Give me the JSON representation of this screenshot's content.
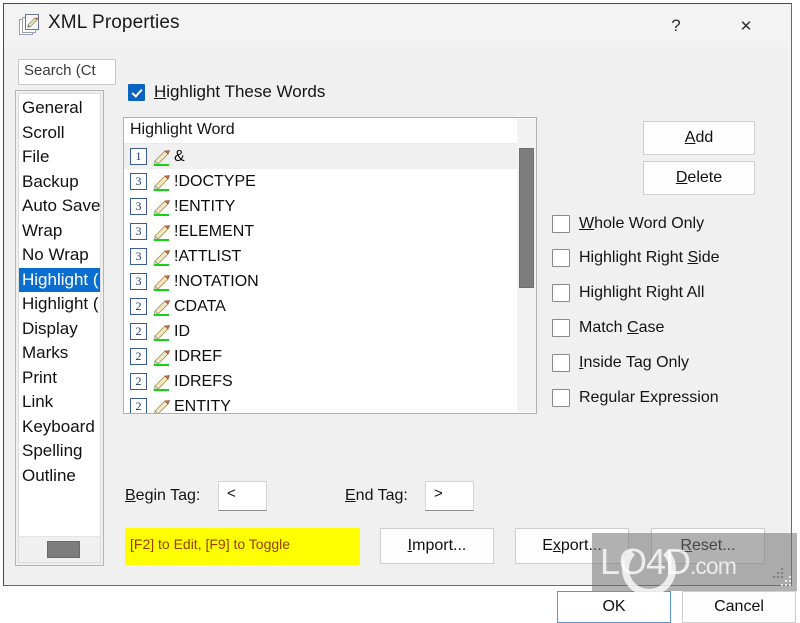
{
  "window": {
    "title": "XML Properties",
    "icon": "document-properties-icon",
    "help_label": "?",
    "close_label": "✕"
  },
  "sidebar": {
    "search": {
      "value": "Search (Ct",
      "placeholder": "Search (Ctrl+E)"
    },
    "items": [
      {
        "label": "General",
        "selected": false
      },
      {
        "label": "Scroll",
        "selected": false
      },
      {
        "label": "File",
        "selected": false
      },
      {
        "label": "Backup",
        "selected": false
      },
      {
        "label": "Auto Save",
        "selected": false
      },
      {
        "label": "Wrap",
        "selected": false
      },
      {
        "label": "No Wrap",
        "selected": false
      },
      {
        "label": "Highlight (",
        "selected": true
      },
      {
        "label": "Highlight (",
        "selected": false
      },
      {
        "label": "Display",
        "selected": false
      },
      {
        "label": "Marks",
        "selected": false
      },
      {
        "label": "Print",
        "selected": false
      },
      {
        "label": "Link",
        "selected": false
      },
      {
        "label": "Keyboard",
        "selected": false
      },
      {
        "label": "Spelling",
        "selected": false
      },
      {
        "label": "Outline",
        "selected": false
      }
    ]
  },
  "main": {
    "highlight_enabled_label": "Highlight These Words",
    "highlight_enabled_accel": "H",
    "highlight_enabled_checked": true,
    "list": {
      "column_header": "Highlight Word",
      "rows": [
        {
          "level": "1",
          "word": "&",
          "selected": true
        },
        {
          "level": "3",
          "word": "!DOCTYPE",
          "selected": false
        },
        {
          "level": "3",
          "word": "!ENTITY",
          "selected": false
        },
        {
          "level": "3",
          "word": "!ELEMENT",
          "selected": false
        },
        {
          "level": "3",
          "word": "!ATTLIST",
          "selected": false
        },
        {
          "level": "3",
          "word": "!NOTATION",
          "selected": false
        },
        {
          "level": "2",
          "word": "CDATA",
          "selected": false
        },
        {
          "level": "2",
          "word": "ID",
          "selected": false
        },
        {
          "level": "2",
          "word": "IDREF",
          "selected": false
        },
        {
          "level": "2",
          "word": "IDREFS",
          "selected": false
        },
        {
          "level": "2",
          "word": "ENTITY",
          "selected": false
        }
      ]
    },
    "buttons": {
      "add": {
        "accel": "A",
        "rest": "dd"
      },
      "delete": {
        "accel": "D",
        "rest": "elete"
      }
    },
    "options": [
      {
        "accel": "W",
        "pre": "",
        "rest": "hole Word Only",
        "checked": false
      },
      {
        "accel": "S",
        "pre": "Highlight Right ",
        "rest": "ide",
        "checked": false
      },
      {
        "accel": "",
        "pre": "Highlight Right All",
        "rest": "",
        "checked": false
      },
      {
        "accel": "C",
        "pre": "Match ",
        "rest": "ase",
        "checked": false
      },
      {
        "accel": "I",
        "pre": "",
        "rest": "nside Tag Only",
        "checked": false
      },
      {
        "accel": "",
        "pre": "Regular Expression",
        "rest": "",
        "checked": false
      }
    ],
    "tags": {
      "begin_label_accel": "B",
      "begin_label_rest": "egin Tag:",
      "begin_value": "<",
      "end_label_accel": "E",
      "end_label_rest": "nd Tag:",
      "end_value": ">"
    },
    "hint": "[F2] to Edit, [F9] to Toggle",
    "actions": {
      "import": {
        "accel": "I",
        "pre": "",
        "rest": "mport..."
      },
      "export": {
        "accel": "x",
        "pre": "E",
        "rest": "port..."
      },
      "reset": {
        "accel": "R",
        "pre": "",
        "rest": "eset..."
      }
    }
  },
  "footer": {
    "ok": "OK",
    "cancel": "Cancel"
  },
  "watermark": {
    "text_main": "LO4D",
    "text_suffix": ".com"
  },
  "colors": {
    "accent": "#0a6ed1",
    "hint_background": "#ffff00",
    "hint_text": "#9a3b00",
    "dialog_background": "#f0f0f0"
  }
}
